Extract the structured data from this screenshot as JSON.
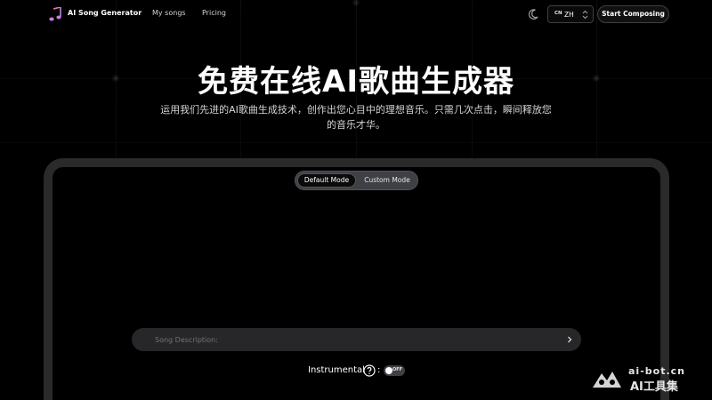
{
  "nav": {
    "brand": "AI Song Generator",
    "links": [
      "My songs",
      "Pricing"
    ],
    "language": {
      "flag": "CN",
      "value": "ZH"
    },
    "start_button": "Start Composing",
    "theme_icon": "moon-icon"
  },
  "hero": {
    "title": "免费在线AI歌曲生成器",
    "subtitle": "运用我们先进的AI歌曲生成技术，创作出您心目中的理想音乐。只需几次点击，瞬间释放您的音乐才华。"
  },
  "modes": {
    "default": "Default Mode",
    "custom": "Custom Mode",
    "selected": "Default Mode"
  },
  "description": {
    "placeholder": "Song Description:"
  },
  "instrumental": {
    "label": "Instrumental",
    "toggle_state": "OFF"
  },
  "watermark": {
    "url": "ai-bot.cn",
    "name": "AI工具集"
  },
  "colors": {
    "background": "#000000",
    "panel_border": "#2a2a2a",
    "input_bg": "#27272a"
  }
}
